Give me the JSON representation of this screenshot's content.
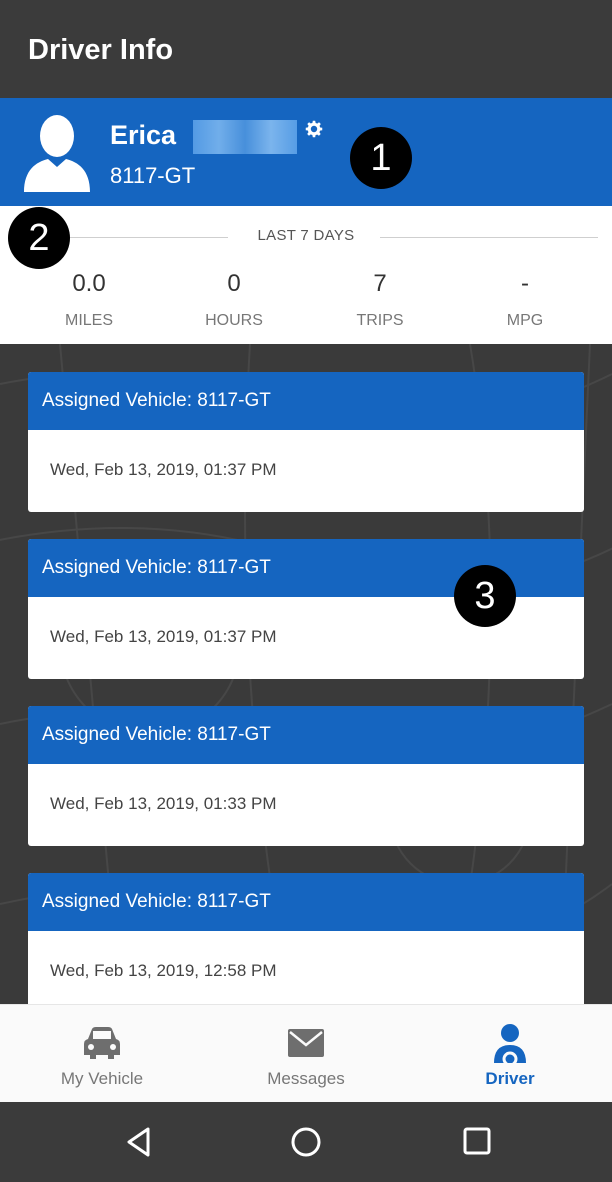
{
  "app_bar": {
    "title": "Driver Info"
  },
  "profile": {
    "name": "Erica",
    "vehicle_id": "8117-GT"
  },
  "callouts": [
    "1",
    "2",
    "3"
  ],
  "stats": {
    "period_label": "LAST 7 DAYS",
    "items": [
      {
        "value": "0.0",
        "label": "MILES"
      },
      {
        "value": "0",
        "label": "HOURS"
      },
      {
        "value": "7",
        "label": "TRIPS"
      },
      {
        "value": "-",
        "label": "MPG"
      }
    ]
  },
  "cards": [
    {
      "title": "Assigned Vehicle: 8117-GT",
      "date": "Wed, Feb 13, 2019, 01:37 PM"
    },
    {
      "title": "Assigned Vehicle: 8117-GT",
      "date": "Wed, Feb 13, 2019, 01:37 PM"
    },
    {
      "title": "Assigned Vehicle: 8117-GT",
      "date": "Wed, Feb 13, 2019, 01:33 PM"
    },
    {
      "title": "Assigned Vehicle: 8117-GT",
      "date": "Wed, Feb 13, 2019, 12:58 PM"
    }
  ],
  "bottom_nav": {
    "items": [
      {
        "label": "My Vehicle",
        "icon": "car-icon"
      },
      {
        "label": "Messages",
        "icon": "envelope-icon"
      },
      {
        "label": "Driver",
        "icon": "driver-icon",
        "active": true
      }
    ]
  },
  "system_nav": {
    "icons": [
      "back-icon",
      "home-icon",
      "recents-icon"
    ]
  },
  "colors": {
    "brand_blue": "#1565c0",
    "app_bar": "#3b3b3b",
    "background": "#3a3a3a"
  }
}
